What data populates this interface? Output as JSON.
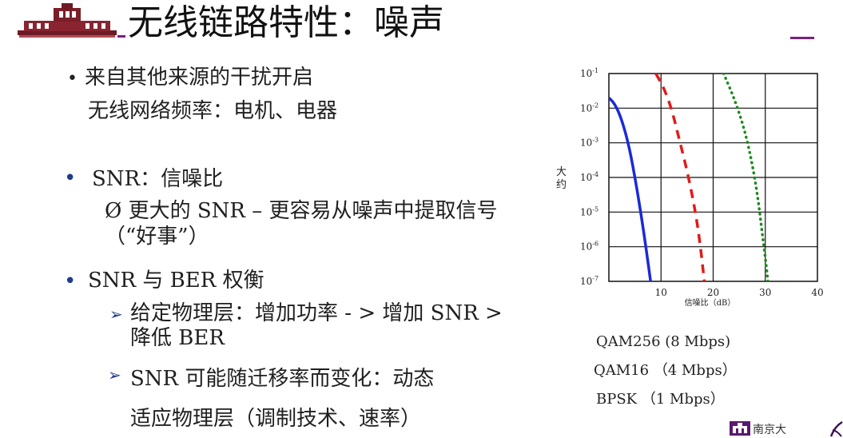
{
  "slide": {
    "title": "无线链路特性：噪声"
  },
  "body": {
    "b1_marker": "•",
    "b1_text": "来自其他来源的干扰开启",
    "b1_sub": "无线网络频率：电机、电器",
    "b2_marker": "•",
    "b2_text": "SNR：信噪比",
    "b2_sub1": "Ø 更大的 SNR – 更容易从噪声中提取信号",
    "b2_sub2": "（“好事”）",
    "b3_marker": "•",
    "b3_text": "SNR 与 BER 权衡",
    "b3_sub1_marker": "➢",
    "b3_sub1_line1": "给定物理层：增加功率 - > 增加 SNR >",
    "b3_sub1_line2": "降低 BER",
    "b3_sub2_marker": "➢",
    "b3_sub2_line1": "SNR 可能随迁移率而变化：动态",
    "b3_sub2_line2": "适应物理层（调制技术、速率）"
  },
  "chart_data": {
    "type": "line",
    "ylabel": "大约",
    "xlabel": "信噪比（dB）",
    "xlim": [
      0,
      40
    ],
    "ylim_log10": [
      -7,
      -1
    ],
    "x_ticks": [
      "10",
      "20",
      "30",
      "40"
    ],
    "y_ticks": [
      {
        "base": "10",
        "exp": "-1"
      },
      {
        "base": "10",
        "exp": "-2"
      },
      {
        "base": "10",
        "exp": "-3"
      },
      {
        "base": "10",
        "exp": "-4"
      },
      {
        "base": "10",
        "exp": "-5"
      },
      {
        "base": "10",
        "exp": "-6"
      },
      {
        "base": "10",
        "exp": "-7"
      }
    ],
    "grid": true,
    "series": [
      {
        "name": "BPSK （1 Mbps）",
        "color": "#1a2ad8",
        "style": "solid",
        "points": [
          [
            0,
            -1.7
          ],
          [
            1,
            -1.85
          ],
          [
            2,
            -2.15
          ],
          [
            3,
            -2.6
          ],
          [
            4,
            -3.2
          ],
          [
            5,
            -4.0
          ],
          [
            6,
            -4.9
          ],
          [
            7,
            -5.9
          ],
          [
            8,
            -7.0
          ]
        ]
      },
      {
        "name": "QAM16 （4 Mbps）",
        "color": "#e01b1b",
        "style": "dashed",
        "points": [
          [
            9,
            -1.0
          ],
          [
            10.5,
            -1.4
          ],
          [
            12,
            -2.0
          ],
          [
            13.5,
            -2.9
          ],
          [
            15,
            -3.8
          ],
          [
            16.5,
            -4.9
          ],
          [
            17.5,
            -5.9
          ],
          [
            18.3,
            -7.0
          ]
        ]
      },
      {
        "name": "QAM256 (8 Mbps)",
        "color": "#1f8a1f",
        "style": "dotted",
        "points": [
          [
            22,
            -1.0
          ],
          [
            24,
            -1.7
          ],
          [
            26,
            -2.6
          ],
          [
            27.5,
            -3.6
          ],
          [
            28.6,
            -4.6
          ],
          [
            29.4,
            -5.6
          ],
          [
            30,
            -6.3
          ],
          [
            30.5,
            -7.0
          ]
        ]
      }
    ]
  },
  "legend": {
    "qam256": "QAM256 (8 Mbps)",
    "qam16": "QAM16 （4 Mbps）",
    "bpsk": "BPSK （1 Mbps）"
  },
  "footer": {
    "text": "南京大"
  }
}
